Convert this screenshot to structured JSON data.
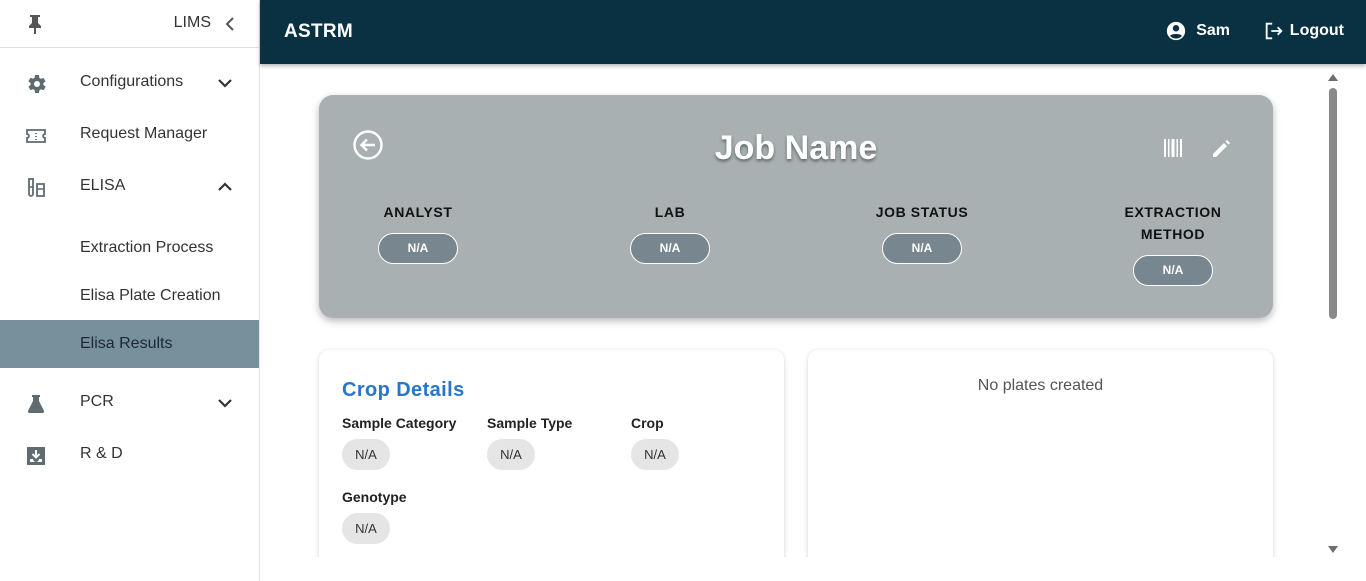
{
  "sidebar": {
    "title": "LIMS",
    "items": [
      {
        "label": "Configurations",
        "icon": "gear-icon"
      },
      {
        "label": "Request Manager",
        "icon": "ticket-icon"
      },
      {
        "label": "ELISA",
        "icon": "test-tubes-icon"
      },
      {
        "label": "PCR",
        "icon": "flask-icon"
      },
      {
        "label": "R & D",
        "icon": "inbox-download-icon"
      }
    ],
    "elisa_subitems": [
      {
        "label": "Extraction Process"
      },
      {
        "label": "Elisa Plate Creation"
      },
      {
        "label": "Elisa Results",
        "active": true
      }
    ]
  },
  "topbar": {
    "brand": "ASTRM",
    "user": "Sam",
    "logout": "Logout"
  },
  "job": {
    "title": "Job Name",
    "fields": [
      {
        "label": "ANALYST",
        "value": "N/A"
      },
      {
        "label": "LAB",
        "value": "N/A"
      },
      {
        "label": "JOB STATUS",
        "value": "N/A"
      },
      {
        "label": "EXTRACTION METHOD",
        "value": "N/A"
      }
    ]
  },
  "crop": {
    "title": "Crop Details",
    "fields": [
      {
        "label": "Sample Category",
        "value": "N/A"
      },
      {
        "label": "Sample Type",
        "value": "N/A"
      },
      {
        "label": "Crop",
        "value": "N/A"
      },
      {
        "label": "Genotype",
        "value": "N/A"
      }
    ]
  },
  "plates": {
    "empty_text": "No plates created"
  },
  "colors": {
    "topbar": "#0a3142",
    "active_nav": "#78909c",
    "job_card": "#a8b0b2",
    "crop_title": "#2677c9"
  }
}
